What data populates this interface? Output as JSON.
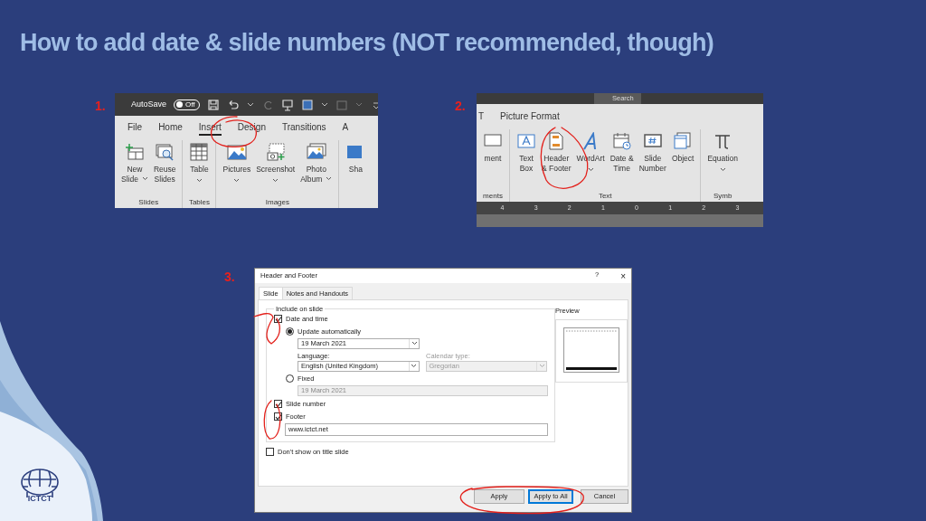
{
  "title": "How to add date & slide numbers (NOT recommended, though)",
  "ribbon_insert": {
    "step": "1.",
    "autosave": {
      "label": "AutoSave",
      "toggle": "Off",
      "on": false
    },
    "tabs": [
      {
        "label": "File",
        "selected": false
      },
      {
        "label": "Home",
        "selected": false
      },
      {
        "label": "Insert",
        "selected": true
      },
      {
        "label": "Design",
        "selected": false
      },
      {
        "label": "Transitions",
        "selected": false
      },
      {
        "label": "A",
        "selected": false
      }
    ],
    "groups": [
      {
        "label": "Slides",
        "buttons": [
          {
            "lines": [
              "New",
              "Slide"
            ],
            "dropdown": true
          },
          {
            "lines": [
              "Reuse",
              "Slides"
            ],
            "dropdown": false
          }
        ]
      },
      {
        "label": "Tables",
        "buttons": [
          {
            "lines": [
              "Table"
            ],
            "dropdown": true
          }
        ]
      },
      {
        "label": "Images",
        "buttons": [
          {
            "lines": [
              "Pictures"
            ],
            "dropdown": true
          },
          {
            "lines": [
              "Screenshot"
            ],
            "dropdown": true
          },
          {
            "lines": [
              "Photo",
              "Album"
            ],
            "dropdown": true
          }
        ]
      },
      {
        "buttons": [
          {
            "lines": [
              "Sha"
            ],
            "dropdown": false
          }
        ]
      }
    ]
  },
  "ribbon_text": {
    "step": "2.",
    "search": "Search",
    "tabs": [
      {
        "label": "T",
        "selected": false
      },
      {
        "label": "Picture Format",
        "selected": false
      }
    ],
    "groups": [
      {
        "label": "ments",
        "buttons": [
          {
            "lines": [
              "ment"
            ],
            "dropdown": false
          }
        ]
      },
      {
        "label": "Text",
        "buttons": [
          {
            "lines": [
              "Text",
              "Box"
            ],
            "dropdown": false
          },
          {
            "lines": [
              "Header",
              "& Footer"
            ],
            "dropdown": false
          },
          {
            "lines": [
              "WordArt"
            ],
            "dropdown": true
          },
          {
            "lines": [
              "Date &",
              "Time"
            ],
            "dropdown": false
          },
          {
            "lines": [
              "Slide",
              "Number"
            ],
            "dropdown": false
          },
          {
            "lines": [
              "Object"
            ],
            "dropdown": false
          }
        ]
      },
      {
        "label": "Symb",
        "buttons": [
          {
            "lines": [
              "Equation"
            ],
            "dropdown": true
          }
        ]
      }
    ],
    "ruler": [
      "4",
      "3",
      "2",
      "1",
      "0",
      "1",
      "2",
      "3"
    ]
  },
  "dialog": {
    "step": "3.",
    "title": "Header and Footer",
    "help": "?",
    "close": "×",
    "tabs": [
      {
        "label": "Slide",
        "selected": true
      },
      {
        "label": "Notes and Handouts",
        "selected": false
      }
    ],
    "group_label": "Include on slide",
    "date_time": {
      "label": "Date and time",
      "checked": true
    },
    "update_auto": {
      "label": "Update automatically",
      "selected": true
    },
    "date_select": {
      "value": "19 March 2021"
    },
    "language": {
      "label": "Language:",
      "value": "English (United Kingdom)"
    },
    "calendar": {
      "label": "Calendar type:",
      "value": "Gregorian",
      "disabled": true
    },
    "fixed": {
      "label": "Fixed",
      "selected": false
    },
    "fixed_value": {
      "value": "19 March 2021",
      "disabled": true
    },
    "slide_number": {
      "label": "Slide number",
      "checked": true
    },
    "footer": {
      "label": "Footer",
      "checked": true
    },
    "footer_text": {
      "value": "www.ictct.net"
    },
    "dont_show": {
      "label": "Don't show on title slide",
      "checked": false
    },
    "preview_label": "Preview",
    "buttons": [
      {
        "label": "Apply",
        "default": false
      },
      {
        "label": "Apply to All",
        "default": true
      },
      {
        "label": "Cancel",
        "default": false
      }
    ]
  },
  "logo": {
    "text": "ICTCT"
  }
}
